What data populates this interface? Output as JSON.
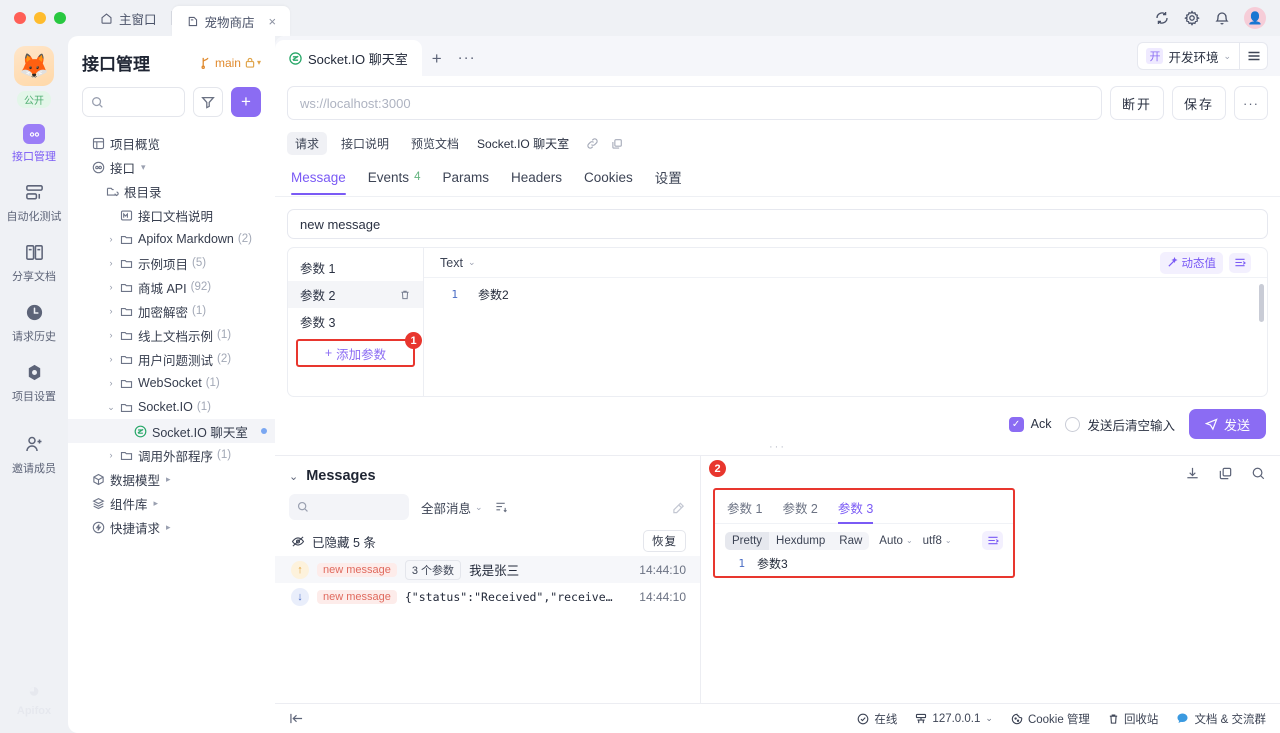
{
  "titlebar": {
    "home_tab": "主窗口",
    "active_tab": "宠物商店",
    "close_label": "×",
    "icons": [
      "sync-icon",
      "gear-icon",
      "bell-icon",
      "avatar"
    ]
  },
  "rail": {
    "public_badge": "公开",
    "items": [
      {
        "label": "接口管理",
        "icon": "api-icon",
        "active": true
      },
      {
        "label": "自动化测试",
        "icon": "automation-icon",
        "active": false
      },
      {
        "label": "分享文档",
        "icon": "share-doc-icon",
        "active": false
      },
      {
        "label": "请求历史",
        "icon": "clock-icon",
        "active": false
      },
      {
        "label": "项目设置",
        "icon": "settings-icon",
        "active": false
      },
      {
        "label": "邀请成员",
        "icon": "invite-icon",
        "active": false
      }
    ],
    "footer_label": "Apifox"
  },
  "leftpanel": {
    "title": "接口管理",
    "branch": "main",
    "search_placeholder": "",
    "tree": [
      {
        "label": "项目概览",
        "indent": 0,
        "icon": "overview-icon",
        "caret": "",
        "count": "",
        "arrow": ""
      },
      {
        "label": "接口",
        "indent": 0,
        "icon": "api-icon",
        "caret": "",
        "count": "",
        "arrow": "▾"
      },
      {
        "label": "根目录",
        "indent": 1,
        "icon": "root-folder-icon",
        "caret": "",
        "count": "",
        "arrow": ""
      },
      {
        "label": "接口文档说明",
        "indent": 2,
        "icon": "markdown-icon",
        "caret": "",
        "count": "",
        "arrow": ""
      },
      {
        "label": "Apifox Markdown",
        "indent": 2,
        "icon": "folder-icon",
        "caret": "›",
        "count": "(2)",
        "arrow": ""
      },
      {
        "label": "示例项目",
        "indent": 2,
        "icon": "folder-icon",
        "caret": "›",
        "count": "(5)",
        "arrow": ""
      },
      {
        "label": "商城 API",
        "indent": 2,
        "icon": "folder-icon",
        "caret": "›",
        "count": "(92)",
        "arrow": ""
      },
      {
        "label": "加密解密",
        "indent": 2,
        "icon": "folder-icon",
        "caret": "›",
        "count": "(1)",
        "arrow": ""
      },
      {
        "label": "线上文档示例",
        "indent": 2,
        "icon": "folder-icon",
        "caret": "›",
        "count": "(1)",
        "arrow": ""
      },
      {
        "label": "用户问题测试",
        "indent": 2,
        "icon": "folder-icon",
        "caret": "›",
        "count": "(2)",
        "arrow": ""
      },
      {
        "label": "WebSocket",
        "indent": 2,
        "icon": "folder-icon",
        "caret": "›",
        "count": "(1)",
        "arrow": ""
      },
      {
        "label": "Socket.IO",
        "indent": 2,
        "icon": "folder-icon",
        "caret": "⌄",
        "count": "(1)",
        "arrow": ""
      },
      {
        "label": "Socket.IO 聊天室",
        "indent": 3,
        "icon": "socketio-icon",
        "caret": "",
        "count": "",
        "arrow": "",
        "selected": true,
        "dot": true
      },
      {
        "label": "调用外部程序",
        "indent": 2,
        "icon": "folder-icon",
        "caret": "›",
        "count": "(1)",
        "arrow": ""
      },
      {
        "label": "数据模型",
        "indent": 0,
        "icon": "model-icon",
        "caret": "",
        "count": "",
        "arrow": "▸"
      },
      {
        "label": "组件库",
        "indent": 0,
        "icon": "component-icon",
        "caret": "",
        "count": "",
        "arrow": "▸"
      },
      {
        "label": "快捷请求",
        "indent": 0,
        "icon": "quick-request-icon",
        "caret": "",
        "count": "",
        "arrow": "▸"
      }
    ]
  },
  "doc": {
    "tab_title": "Socket.IO 聊天室",
    "add_tab": "+",
    "more_tab": "···",
    "env_chip": "开",
    "env_name": "开发环境",
    "url_placeholder": "ws://localhost:3000",
    "btn_disconnect": "断开",
    "btn_save": "保存",
    "btn_more": "···",
    "subtabs": [
      "请求",
      "接口说明",
      "预览文档"
    ],
    "subtab_name": "Socket.IO 聊天室",
    "tabs": [
      {
        "label": "Message",
        "count": "",
        "active": true
      },
      {
        "label": "Events",
        "count": "4",
        "active": false
      },
      {
        "label": "Params",
        "count": "",
        "active": false
      },
      {
        "label": "Headers",
        "count": "",
        "active": false
      },
      {
        "label": "Cookies",
        "count": "",
        "active": false
      },
      {
        "label": "设置",
        "count": "",
        "active": false
      }
    ]
  },
  "message": {
    "event_name": "new message",
    "params": [
      {
        "label": "参数 1",
        "selected": false
      },
      {
        "label": "参数 2",
        "selected": true
      },
      {
        "label": "参数 3",
        "selected": false
      }
    ],
    "add_param": "添加参数",
    "add_param_badge": "1",
    "editor_type": "Text",
    "dynamic_value": "动态值",
    "code_line_no": "1",
    "code_text": "参数2",
    "ack_label": "Ack",
    "clear_label": "发送后清空输入",
    "send_label": "发送"
  },
  "messages": {
    "title": "Messages",
    "search_placeholder": "",
    "filter_label": "全部消息",
    "hidden_label": "已隐藏 5 条",
    "restore_label": "恢复",
    "rows": [
      {
        "direction": "up",
        "event": "new message",
        "param_count": "3 个参数",
        "text": "我是张三",
        "time": "14:44:10",
        "highlight": true,
        "mono": false
      },
      {
        "direction": "down",
        "event": "new message",
        "param_count": "",
        "text": "{\"status\":\"Received\",\"receive…",
        "time": "14:44:10",
        "highlight": false,
        "mono": true
      }
    ]
  },
  "detail": {
    "badge": "2",
    "params": [
      {
        "label": "参数 1",
        "active": false
      },
      {
        "label": "参数 2",
        "active": false
      },
      {
        "label": "参数 3",
        "active": true
      }
    ],
    "modes": [
      {
        "label": "Pretty",
        "on": true
      },
      {
        "label": "Hexdump",
        "on": false
      },
      {
        "label": "Raw",
        "on": false
      }
    ],
    "auto_label": "Auto",
    "charset_label": "utf8",
    "code_line_no": "1",
    "code_text": "参数3",
    "top_icons": [
      "download-icon",
      "copy-icon",
      "search-icon"
    ]
  },
  "statusbar": {
    "collapse_icon": "collapse-left-icon",
    "items": [
      {
        "label": "在线",
        "icon": "online-icon",
        "caret": ""
      },
      {
        "label": "127.0.0.1",
        "icon": "host-icon",
        "caret": "⌄"
      },
      {
        "label": "Cookie 管理",
        "icon": "cookie-icon",
        "caret": ""
      },
      {
        "label": "回收站",
        "icon": "trash-icon",
        "caret": ""
      },
      {
        "label": "文档 & 交流群",
        "icon": "chat-icon",
        "caret": ""
      }
    ]
  },
  "colors": {
    "accent": "#8b6cf3",
    "highlight_red": "#e8362e",
    "green": "#2aa86a",
    "tag_red": "#e06a5e"
  }
}
